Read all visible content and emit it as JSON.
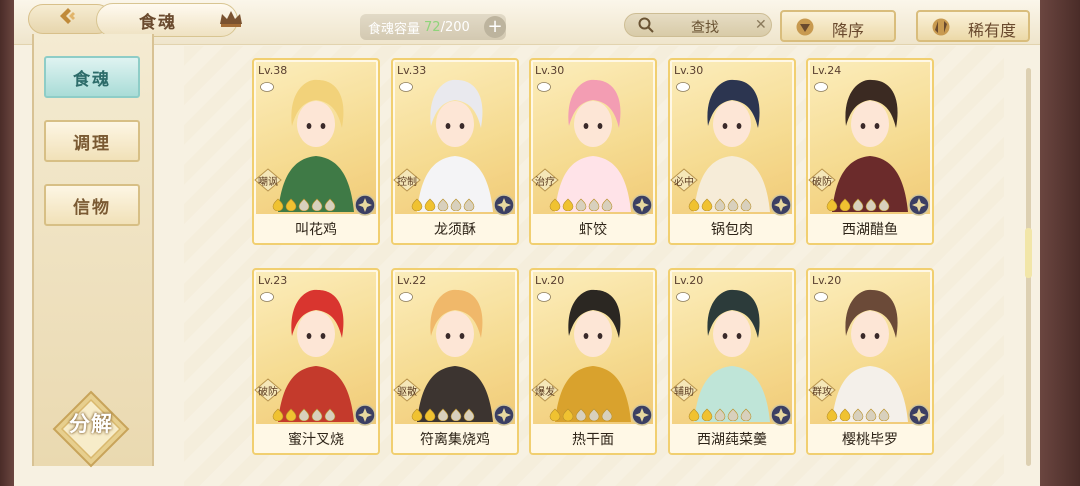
{
  "header": {
    "title": "食魂",
    "capacity_label": "食魂容量",
    "capacity_current": "72",
    "capacity_max": "/200",
    "search_placeholder": "查找",
    "sort_order_label": "降序",
    "sort_rarity_label": "稀有度"
  },
  "sidebar": {
    "tabs": [
      {
        "label": "食魂",
        "active": true
      },
      {
        "label": "调理",
        "active": false
      },
      {
        "label": "信物",
        "active": false
      }
    ],
    "decompose_label": "分解"
  },
  "cards": [
    {
      "level": "Lv.38",
      "name": "叫花鸡",
      "role": "嘲讽",
      "stars": 2,
      "hair": "#f2d27a",
      "cloth": "#3f7a46",
      "badge_color": "#3b3f63"
    },
    {
      "level": "Lv.33",
      "name": "龙须酥",
      "role": "控制",
      "stars": 2,
      "hair": "#e9e9ee",
      "cloth": "#f4f4f6",
      "badge_color": "#3b3f63"
    },
    {
      "level": "Lv.30",
      "name": "虾饺",
      "role": "治疗",
      "stars": 2,
      "hair": "#f39db3",
      "cloth": "#ffe3e8",
      "badge_color": "#3b3f63"
    },
    {
      "level": "Lv.30",
      "name": "锅包肉",
      "role": "必中",
      "stars": 2,
      "hair": "#2c3550",
      "cloth": "#f6ecd8",
      "badge_color": "#3b3f63"
    },
    {
      "level": "Lv.24",
      "name": "西湖醋鱼",
      "role": "破防",
      "stars": 2,
      "hair": "#3b2a22",
      "cloth": "#6b2b2b",
      "badge_color": "#3b3f63"
    },
    {
      "level": "Lv.23",
      "name": "蜜汁叉烧",
      "role": "破防",
      "stars": 2,
      "hair": "#d9352f",
      "cloth": "#c43a2c",
      "badge_color": "#3b3f63"
    },
    {
      "level": "Lv.22",
      "name": "符离集烧鸡",
      "role": "驱散",
      "stars": 2,
      "hair": "#f0b86a",
      "cloth": "#3c3430",
      "badge_color": "#3b3f63"
    },
    {
      "level": "Lv.20",
      "name": "热干面",
      "role": "爆发",
      "stars": 2,
      "hair": "#2b2722",
      "cloth": "#d9a22d",
      "badge_color": "#3b3f63"
    },
    {
      "level": "Lv.20",
      "name": "西湖莼菜羹",
      "role": "辅助",
      "stars": 2,
      "hair": "#2c3b3a",
      "cloth": "#bfe5d8",
      "badge_color": "#3b3f63"
    },
    {
      "level": "Lv.20",
      "name": "樱桃毕罗",
      "role": "群攻",
      "stars": 2,
      "hair": "#6b4a38",
      "cloth": "#f4f0ea",
      "badge_color": "#3b3f63"
    }
  ]
}
